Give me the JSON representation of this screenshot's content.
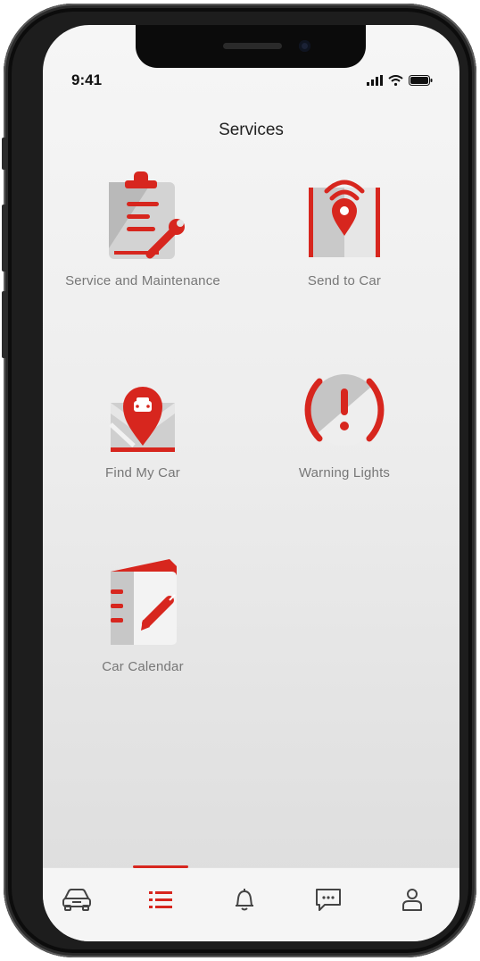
{
  "status_bar": {
    "time": "9:41",
    "signal_icon": "signal-icon",
    "wifi_icon": "wifi-icon",
    "battery_icon": "battery-icon"
  },
  "header": {
    "title": "Services"
  },
  "services": [
    {
      "label": "Service and Maintenance",
      "icon": "clipboard-wrench-icon"
    },
    {
      "label": "Send to Car",
      "icon": "map-pin-signal-icon"
    },
    {
      "label": "Find My Car",
      "icon": "car-location-pin-icon"
    },
    {
      "label": "Warning Lights",
      "icon": "warning-exclamation-icon"
    },
    {
      "label": "Car Calendar",
      "icon": "notebook-pencil-icon"
    }
  ],
  "tab_bar": {
    "items": [
      {
        "name": "vehicle",
        "icon": "car-icon",
        "active": false
      },
      {
        "name": "services",
        "icon": "list-icon",
        "active": true
      },
      {
        "name": "notifications",
        "icon": "bell-icon",
        "active": false
      },
      {
        "name": "messages",
        "icon": "chat-icon",
        "active": false
      },
      {
        "name": "profile",
        "icon": "user-icon",
        "active": false
      }
    ]
  },
  "colors": {
    "accent": "#d7261e",
    "icon_gray": "#c9c9c9",
    "label_gray": "#777777"
  }
}
